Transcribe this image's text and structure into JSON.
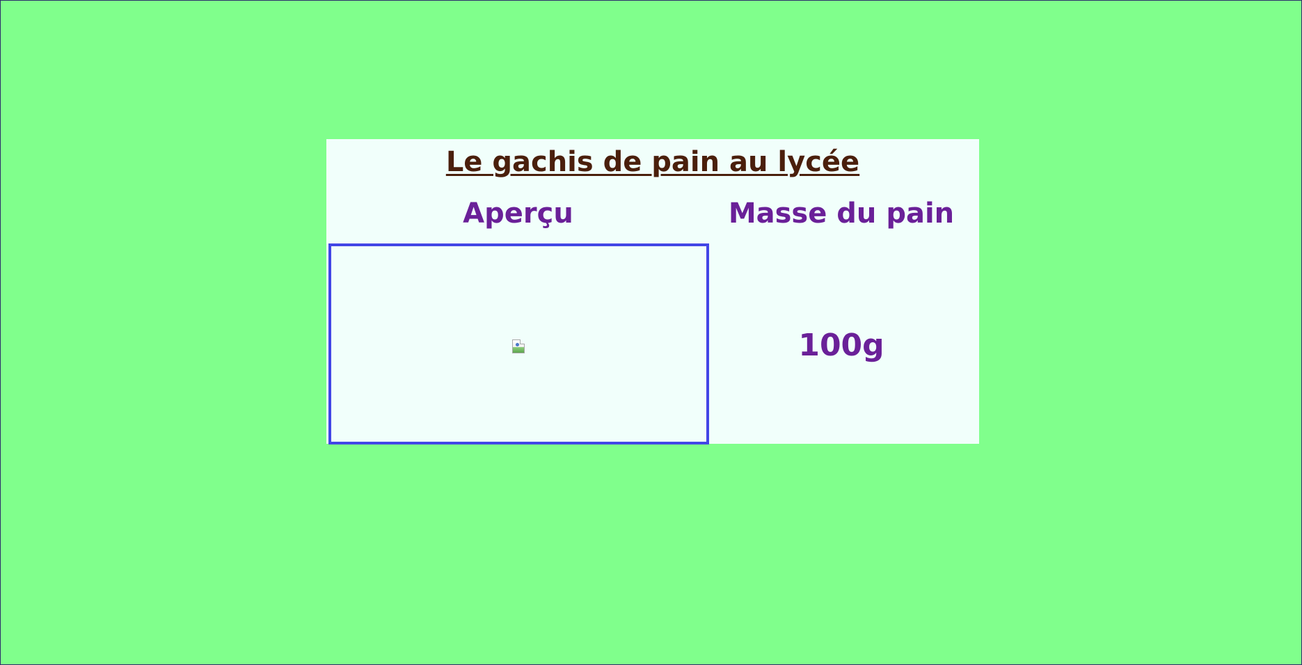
{
  "page": {
    "title": "Le gachis de pain au lycée"
  },
  "columns": {
    "preview_label": "Aperçu",
    "mass_label": "Masse du pain"
  },
  "bread": {
    "mass": "100g"
  },
  "colors": {
    "background": "#80ff8c",
    "panel": "#f1fffb",
    "title": "#4a1f0c",
    "headers": "#6a2098",
    "preview_border": "#4346e6"
  },
  "icons": {
    "preview_image": "broken-image-icon"
  }
}
